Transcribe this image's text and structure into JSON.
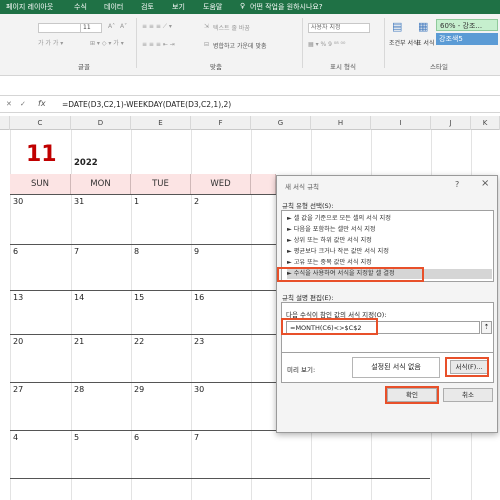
{
  "ribbon": {
    "tabs": [
      "페이지 레이아웃",
      "수식",
      "데이터",
      "검토",
      "보기",
      "도움말"
    ],
    "tell_me": "어떤 작업을 원하시나요?",
    "font_size": "11",
    "wrap_text": "텍스트 줄 바꿈",
    "merge_center": "병합하고 가운데 맞춤",
    "number_format": "사용자 지정",
    "conditional_format": "조건부 서식",
    "table_format": "표 서식",
    "style_good": "60% - 강조...",
    "style_accent": "강조색5",
    "groups": [
      "글꼴",
      "맞춤",
      "표시 형식",
      "스타일"
    ],
    "colors": {
      "tabbar": "#1f7145",
      "good": "#c6efce",
      "accent": "#5b9bd5"
    }
  },
  "formula_bar": {
    "fx": "fx",
    "formula": "=DATE(D3,C2,1)-WEEKDAY(DATE(D3,C2,1),2)"
  },
  "columns": [
    "C",
    "D",
    "E",
    "F",
    "G",
    "H",
    "I",
    "J",
    "K"
  ],
  "calendar": {
    "month": "11",
    "year": "2022",
    "weekdays": [
      "SUN",
      "MON",
      "TUE",
      "WED"
    ],
    "week_rows": [
      [
        "30",
        "31",
        "1",
        "2"
      ],
      [
        "6",
        "7",
        "8",
        "9"
      ],
      [
        "13",
        "14",
        "15",
        "16"
      ],
      [
        "20",
        "21",
        "22",
        "23"
      ],
      [
        "27",
        "28",
        "29",
        "30"
      ],
      [
        "4",
        "5",
        "6",
        "7"
      ]
    ],
    "month_color": "#c00000"
  },
  "dialog": {
    "title": "새 서식 규칙",
    "help": "?",
    "close": "×",
    "rule_type_label": "규칙 유형 선택(S):",
    "rule_types": [
      "► 셀 값을 기준으로 모든 셀의 서식 지정",
      "► 다음을 포함하는 셀만 서식 지정",
      "► 상위 또는 하위 값만 서식 지정",
      "► 평균보다 크거나 작은 값만 서식 지정",
      "► 고유 또는 중복 값만 서식 지정",
      "► 수식을 사용하여 서식을 지정할 셀 결정"
    ],
    "edit_label": "규칙 설명 편집(E):",
    "formula_label": "다음 수식이 참인 값의 서식 지정(O):",
    "formula_value": "=MONTH(C6)<>$C$2",
    "preview_label": "미리 보기:",
    "preview_text": "설정된 서식 없음",
    "format_button": "서식(F)...",
    "ok": "확인",
    "cancel": "취소",
    "highlight_color": "#e8502a"
  }
}
